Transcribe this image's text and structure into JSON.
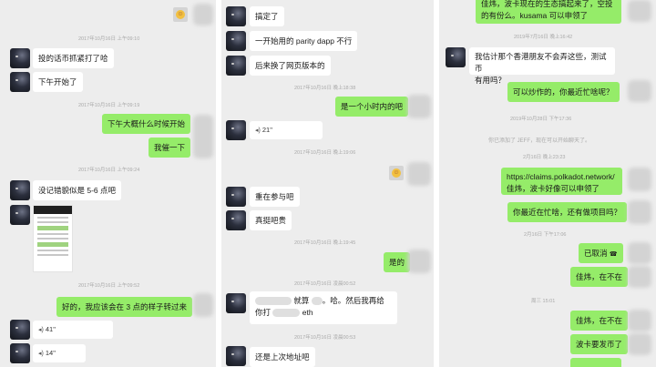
{
  "panel1": {
    "timestamps": [
      "2017年10月16日 上午09:10",
      "2017年10月16日 上午09:19",
      "2017年10月16日 上午09:24",
      "2017年10月16日 上午09:52"
    ],
    "messages": {
      "m1": "投的话币抓紧打了哈",
      "m2": "下午开始了",
      "m3": "下午大概什么时候开始",
      "m4": "我催一下",
      "m5": "没记错貌似是 5-6 点吧",
      "m6": "好的，我应该会在 3 点的样子转过来",
      "v1": "41\"",
      "v2": "14\""
    }
  },
  "panel2": {
    "timestamps": [
      "2017年10月16日 晚上18:38",
      "2017年10月16日 晚上19:06",
      "2017年10月16日 晚上19:45",
      "2017年10月16日 凌晨00:52",
      "2017年10月16日 凌晨00:53"
    ],
    "messages": {
      "m1": "搞定了",
      "m2": "一开始用的 parity dapp 不行",
      "m3": "后来换了网页版本的",
      "m4": "是一个小时内的吧",
      "m5": "重在参与吧",
      "m6": "真挺吧贵",
      "m7": "是的",
      "m8a": "就算",
      "m8b": "。哈。然后我再给",
      "m8c": "你打",
      "m8d": "eth",
      "m9": "还是上次地址吧",
      "v1": "21\""
    }
  },
  "panel3": {
    "timestamps": [
      "2019年7月16日 晚上16:42",
      "2019年10月28日 下午17:36",
      "2月16日 晚上23:23",
      "2月16日 下午17:06",
      "周三 15:01"
    ],
    "system": "你已添加了 JEFF，现在可以开始聊天了。",
    "messages": {
      "m1a": "佳炜，波卡现在的生态搞起来了，空投",
      "m1b": "的有份么。kusama 可以申领了",
      "m2a": "我估计那个香港朋友不会弄这些，测试币",
      "m2b": "有用吗？",
      "m3": "可以炒作的，你最近忙啥呢？",
      "m4a": "https://claims.polkadot.network/",
      "m4b": "佳炜，波卡好像可以申领了",
      "m5": "你最近在忙啥，还有做项目吗？",
      "m6": "已取消",
      "m7": "佳炜，在不在",
      "m8": "佳炜，在不在",
      "m9": "波卡要发币了"
    }
  },
  "colors": {
    "outgoing": "#95ec69",
    "incoming": "#ffffff",
    "background": "#ededed"
  }
}
